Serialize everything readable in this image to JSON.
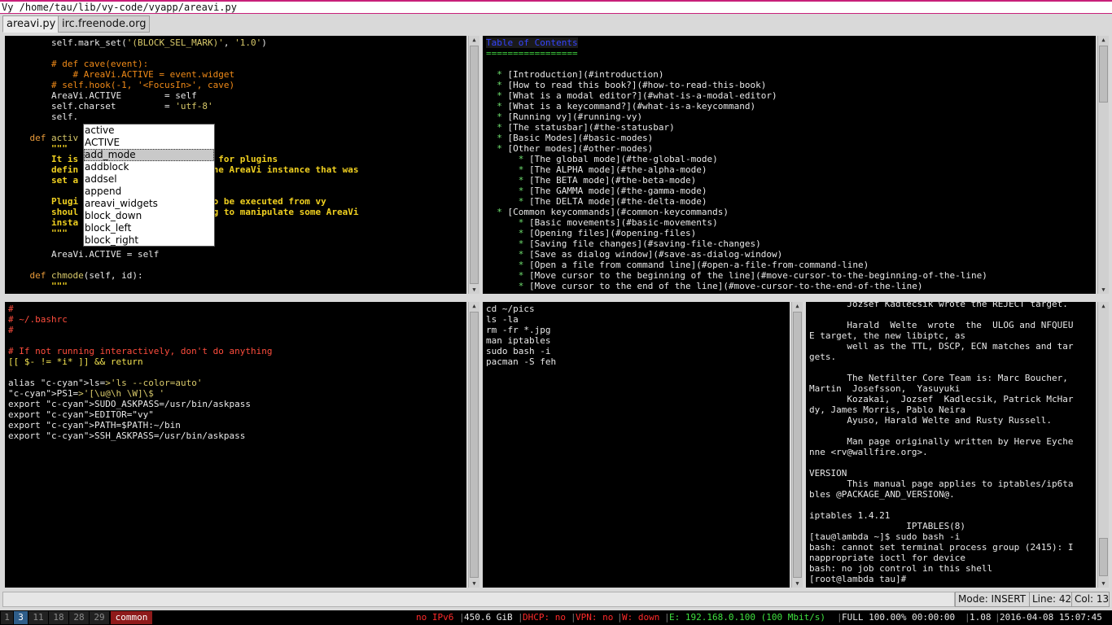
{
  "window": {
    "title": "Vy /home/tau/lib/vy-code/vyapp/areavi.py"
  },
  "tabs": [
    {
      "label": "areavi.py",
      "active": true
    },
    {
      "label": "irc.freenode.org",
      "active": false
    }
  ],
  "editor_top_left": {
    "lines": [
      "        self.mark_set('(BLOCK_SEL_MARK)', '1.0')",
      "",
      "        # def cave(event):",
      "            # AreaVi.ACTIVE = event.widget",
      "        # self.hook(-1, '<FocusIn>', cave)",
      "        AreaVi.ACTIVE        = self",
      "        self.charset         = 'utf-8'",
      "        self.",
      "",
      "    def activ",
      "        \"\"\"",
      "        It is                of target for plugins",
      "        defin                 access the AreaVi instance that was",
      "        set a",
      "",
      "        Plugi               unctions to be executed from vy",
      "        shoul               when having to manipulate some AreaVi",
      "        insta",
      "        \"\"\"",
      "",
      "        AreaVi.ACTIVE = self",
      "",
      "    def chmode(self, id):",
      "        \"\"\""
    ]
  },
  "autocomplete": {
    "items": [
      "active",
      "ACTIVE",
      "add_mode",
      "addblock",
      "addsel",
      "append",
      "areavi_widgets",
      "block_down",
      "block_left",
      "block_right"
    ],
    "selected_index": 2
  },
  "editor_top_right": {
    "lines": [
      "Table of Contents",
      "=================",
      "",
      "  * [Introduction](#introduction)",
      "  * [How to read this book?](#how-to-read-this-book)",
      "  * [What is a modal editor?](#what-is-a-modal-editor)",
      "  * [What is a keycommand?](#what-is-a-keycommand)",
      "  * [Running vy](#running-vy)",
      "  * [The statusbar](#the-statusbar)",
      "  * [Basic Modes](#basic-modes)",
      "  * [Other modes](#other-modes)",
      "      * [The global mode](#the-global-mode)",
      "      * [The ALPHA mode](#the-alpha-mode)",
      "      * [The BETA mode](#the-beta-mode)",
      "      * [The GAMMA mode](#the-gamma-mode)",
      "      * [The DELTA mode](#the-delta-mode)",
      "  * [Common keycommands](#common-keycommands)",
      "      * [Basic movements](#basic-movements)",
      "      * [Opening files](#opening-files)",
      "      * [Saving file changes](#saving-file-changes)",
      "      * [Save as dialog window](#save-as-dialog-window)",
      "      * [Open a file from command line](#open-a-file-from-command-line)",
      "      * [Move cursor to the beginning of the line](#move-cursor-to-the-beginning-of-the-line)",
      "      * [Move cursor to the end of the line](#move-cursor-to-the-end-of-the-line)"
    ]
  },
  "editor_bottom_left": {
    "lines": [
      "#",
      "# ~/.bashrc",
      "#",
      "",
      "# If not running interactively, don't do anything",
      "[[ $- != *i* ]] && return",
      "",
      "alias ls='ls --color=auto'",
      "PS1='[\\u@\\h \\W]\\$ '",
      "export SUDO_ASKPASS=/usr/bin/askpass",
      "export EDITOR=\"vy\"",
      "export PATH=$PATH:~/bin",
      "export SSH_ASKPASS=/usr/bin/askpass"
    ]
  },
  "editor_bottom_middle": {
    "lines": [
      "cd ~/pics",
      "ls -la",
      "rm -fr *.jpg",
      "man iptables",
      "sudo bash -i",
      "pacman -S feh"
    ]
  },
  "editor_bottom_right": {
    "lines": [
      "       Jozsef Kadlecsik wrote the REJECT target.",
      "",
      "       Harald  Welte  wrote  the  ULOG and NFQUEU",
      "E target, the new libiptc, as",
      "       well as the TTL, DSCP, ECN matches and tar",
      "gets.",
      "",
      "       The Netfilter Core Team is: Marc Boucher,",
      "Martin  Josefsson,  Yasuyuki",
      "       Kozakai,  Jozsef  Kadlecsik, Patrick McHar",
      "dy, James Morris, Pablo Neira",
      "       Ayuso, Harald Welte and Rusty Russell.",
      "",
      "       Man page originally written by Herve Eyche",
      "nne <rv@wallfire.org>.",
      "",
      "VERSION",
      "       This manual page applies to iptables/ip6ta",
      "bles @PACKAGE_AND_VERSION@.",
      "",
      "iptables 1.4.21",
      "                  IPTABLES(8)",
      "[tau@lambda ~]$ sudo bash -i",
      "bash: cannot set terminal process group (2415): I",
      "nappropriate ioctl for device",
      "bash: no job control in this shell",
      "[root@lambda tau]#"
    ]
  },
  "statusbar": {
    "mode": "Mode: INSERT",
    "line": "Line: 42",
    "col": "Col: 13"
  },
  "system_bar": {
    "workspaces": [
      "1",
      "3",
      "11",
      "18",
      "28",
      "29",
      "common"
    ],
    "current_workspace": "3",
    "ipv6": "no IPv6",
    "disk": "450.6 GiB",
    "dhcp": "DHCP: no",
    "vpn": "VPN: no",
    "wifi": "W: down",
    "ethernet": "E: 192.168.0.100 (100 Mbit/s)",
    "battery": "FULL 100.00% 00:00:00",
    "load": "1.08",
    "datetime": "2016-04-08 15:07:45"
  },
  "colors": {
    "accent": "#c8207a",
    "editor_bg": "#000000",
    "string": "#d8c96a",
    "comment": "#f08a18",
    "docstring": "#f0d020",
    "bash_comment": "#ff4d3d",
    "bash_var": "#2fd8e8",
    "markdown_bullet": "#6fe06f"
  }
}
